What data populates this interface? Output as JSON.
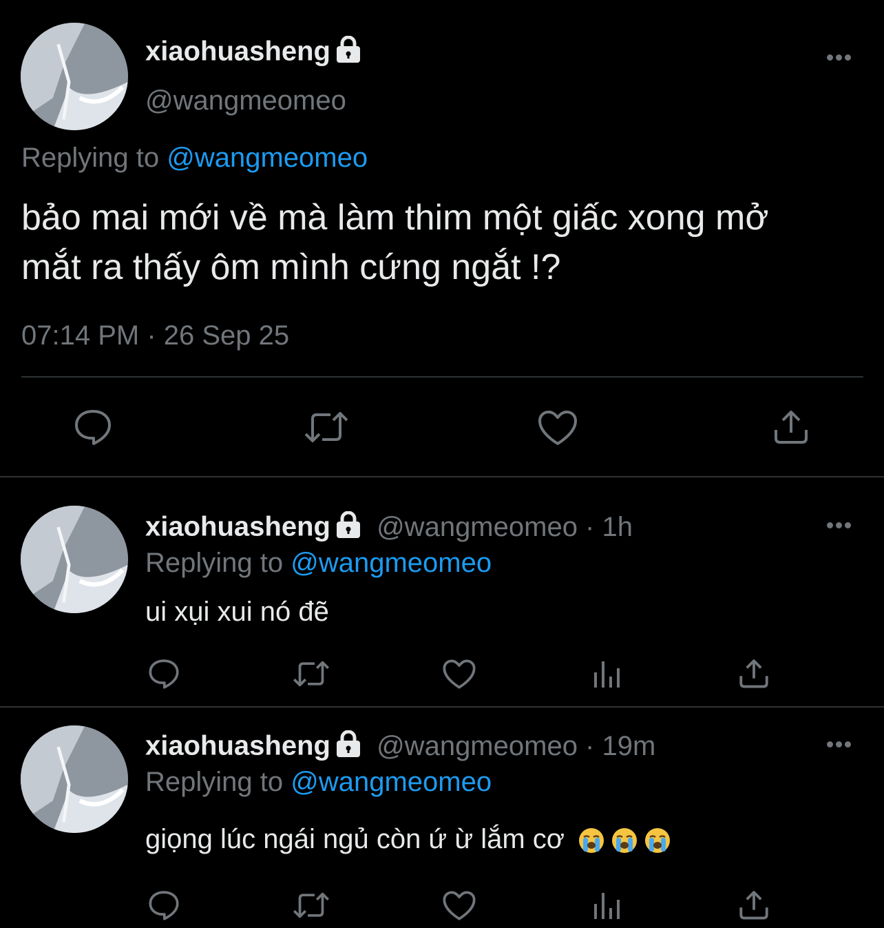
{
  "main_tweet": {
    "display_name": "xiaohuasheng",
    "handle": "@wangmeomeo",
    "replying_prefix": "Replying to",
    "replying_handle": "@wangmeomeo",
    "text_line1": "bảo mai mới về mà làm thim một giấc xong mở",
    "text_line2": "mắt ra thấy ôm mình cứng ngắt !?",
    "timestamp": "07:14 PM · 26 Sep 25"
  },
  "replies": [
    {
      "display_name": "xiaohuasheng",
      "handle_time": "@wangmeomeo · 1h",
      "replying_prefix": "Replying to",
      "replying_handle": "@wangmeomeo",
      "text": "ui xụi xui nó đẽ"
    },
    {
      "display_name": "xiaohuasheng",
      "handle_time": "@wangmeomeo · 19m",
      "replying_prefix": "Replying to",
      "replying_handle": "@wangmeomeo",
      "text": "giọng lúc ngái ngủ còn ứ ừ lắm cơ",
      "emojis": [
        "loudly-crying-face",
        "loudly-crying-face",
        "loudly-crying-face"
      ]
    }
  ],
  "icons": {
    "reply": "reply-icon",
    "retweet": "retweet-icon",
    "like": "heart-icon",
    "share": "share-icon",
    "analytics": "analytics-icon",
    "more": "more-icon",
    "lock": "lock-icon"
  },
  "colors": {
    "background": "#000000",
    "text": "#e7e9ea",
    "muted": "#71767b",
    "link": "#1d9bf0",
    "divider": "#2f3336"
  }
}
